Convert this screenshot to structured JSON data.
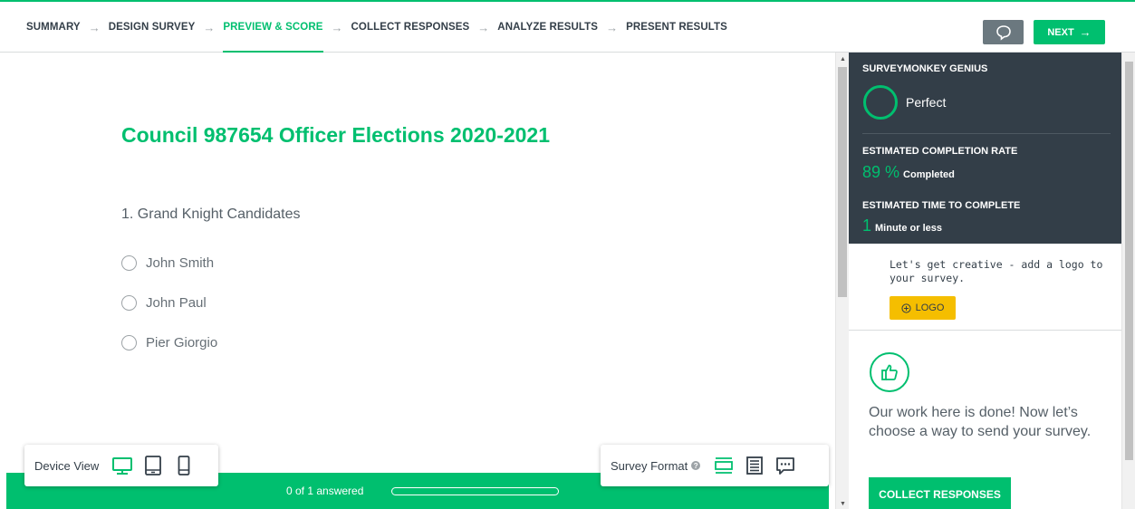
{
  "nav": {
    "steps": [
      {
        "label": "SUMMARY"
      },
      {
        "label": "DESIGN SURVEY"
      },
      {
        "label": "PREVIEW & SCORE"
      },
      {
        "label": "COLLECT RESPONSES"
      },
      {
        "label": "ANALYZE RESULTS"
      },
      {
        "label": "PRESENT RESULTS"
      }
    ],
    "active_step": "PREVIEW & SCORE",
    "next_label": "NEXT",
    "chat_icon": "speech-bubble-icon"
  },
  "survey": {
    "title": "Council 987654 Officer Elections 2020-2021",
    "question": "1. Grand Knight Candidates",
    "options": [
      "John Smith",
      "John Paul",
      "Pier Giorgio"
    ]
  },
  "progress": {
    "text": "0 of 1 answered",
    "fraction": 0
  },
  "device_view": {
    "label": "Device View",
    "icons": [
      "desktop-icon",
      "tablet-icon",
      "phone-icon"
    ],
    "selected": "desktop-icon"
  },
  "survey_format": {
    "label": "Survey Format",
    "icons": [
      "one-question-at-a-time-icon",
      "classic-format-icon",
      "conversation-format-icon"
    ],
    "selected": "one-question-at-a-time-icon"
  },
  "genius": {
    "heading": "SURVEYMONKEY GENIUS",
    "score": "Perfect",
    "completion_heading": "ESTIMATED COMPLETION RATE",
    "completion_value": "89 %",
    "completion_unit": "Completed",
    "time_heading": "ESTIMATED TIME TO COMPLETE",
    "time_value": "1",
    "time_unit": "Minute or less"
  },
  "logo_card": {
    "text": "Let's get creative - add a logo to your survey.",
    "button_label": "LOGO"
  },
  "done_card": {
    "text": "Our work here is done! Now let’s choose a way to send your survey.",
    "button_label": "COLLECT RESPONSES"
  },
  "colors": {
    "accent": "#00bf6f",
    "dark_panel": "#333e48",
    "logo_button": "#f5be00"
  }
}
